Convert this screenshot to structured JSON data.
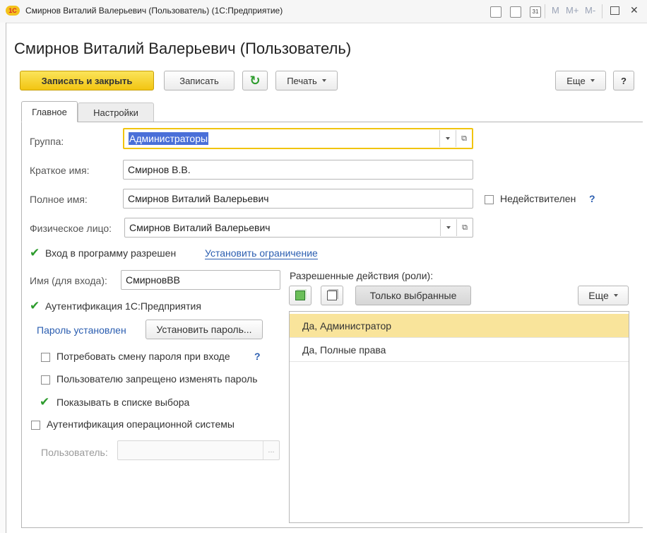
{
  "window": {
    "title": "Смирнов Виталий Валерьевич (Пользователь) (1С:Предприятие)",
    "logo": "1С",
    "toolbar_m": "M",
    "toolbar_mplus": "M+",
    "toolbar_mminus": "M-",
    "close_glyph": "✕",
    "calendar_day": "31"
  },
  "heading": "Смирнов Виталий Валерьевич (Пользователь)",
  "toolbar": {
    "save_close": "Записать и закрыть",
    "save": "Записать",
    "refresh_glyph": "↻",
    "print": "Печать",
    "more": "Еще",
    "help": "?"
  },
  "tabs": [
    {
      "label": "Главное"
    },
    {
      "label": "Настройки"
    }
  ],
  "form": {
    "group_label": "Группа:",
    "group_value": "Администраторы",
    "short_name_label": "Краткое имя:",
    "short_name_value": "Смирнов В.В.",
    "full_name_label": "Полное имя:",
    "full_name_value": "Смирнов Виталий Валерьевич",
    "invalid_label": "Недействителен",
    "help_q": "?",
    "person_label": "Физическое лицо:",
    "person_value": "Смирнов Виталий Валерьевич",
    "login_allowed_label": "Вход в программу разрешен",
    "set_restriction_link": "Установить ограничение",
    "login_name_label": "Имя (для входа):",
    "login_name_value": "СмирновВВ",
    "auth_1c_label": "Аутентификация 1С:Предприятия",
    "password_set_text": "Пароль установлен",
    "set_password_button": "Установить пароль...",
    "require_change_label": "Потребовать смену пароля при входе",
    "forbid_change_label": "Пользователю запрещено изменять пароль",
    "show_in_list_label": "Показывать в списке выбора",
    "auth_os_label": "Аутентификация операционной системы",
    "os_user_label": "Пользователь:",
    "os_user_value": "",
    "ellipsis": "..."
  },
  "roles": {
    "title": "Разрешенные действия (роли):",
    "only_selected_button": "Только выбранные",
    "more_button": "Еще",
    "items": [
      {
        "label": "Да, Администратор",
        "selected": true
      },
      {
        "label": "Да, Полные права",
        "selected": false
      }
    ]
  },
  "colors": {
    "accent": "#f2c512",
    "selection": "#f9e49b",
    "link": "#2a5db0",
    "check": "#2e9c2e"
  }
}
